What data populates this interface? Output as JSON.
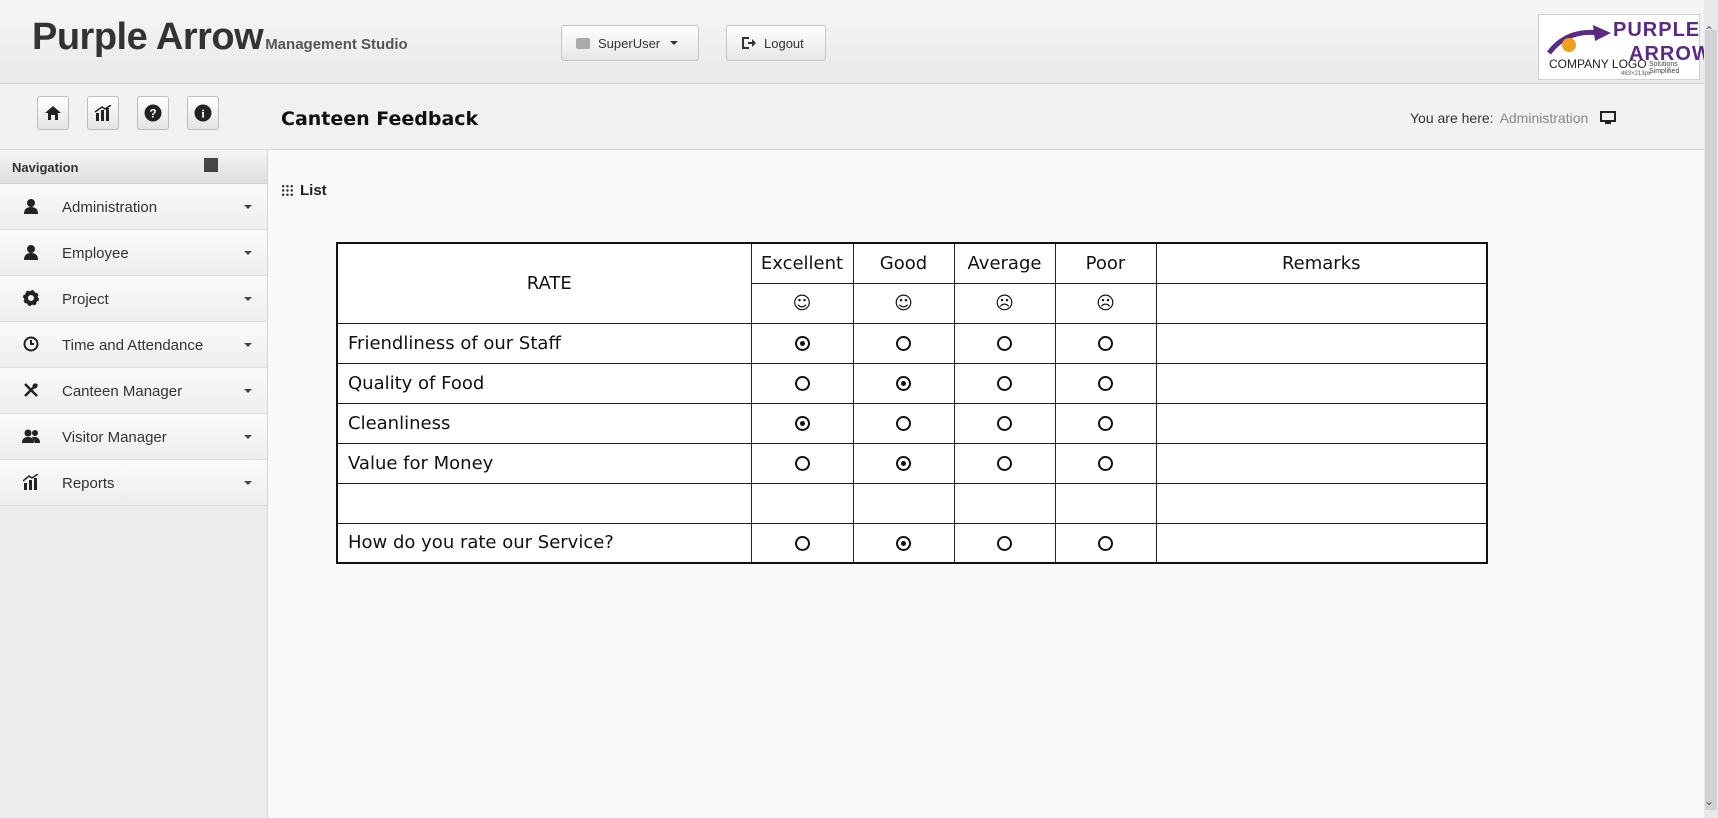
{
  "header": {
    "brand": "Purple Arrow",
    "brand_sub": "Management Studio",
    "user_label": "SuperUser",
    "logout_label": "Logout",
    "logo": {
      "line1": "PURPLE",
      "line2": "ARROW",
      "placeholder": "COMPANY LOGO",
      "tagline": "Solutions Simplified",
      "dims": "483×213px"
    }
  },
  "subheader": {
    "page_title": "Canteen Feedback",
    "breadcrumb_prefix": "You are here:",
    "breadcrumb_item": "Administration"
  },
  "sidebar": {
    "title": "Navigation",
    "items": [
      {
        "label": "Administration",
        "icon": "user-icon"
      },
      {
        "label": "Employee",
        "icon": "user-icon"
      },
      {
        "label": "Project",
        "icon": "gear-icon"
      },
      {
        "label": "Time and Attendance",
        "icon": "clock-icon"
      },
      {
        "label": "Canteen Manager",
        "icon": "utensils-icon"
      },
      {
        "label": "Visitor Manager",
        "icon": "users-icon"
      },
      {
        "label": "Reports",
        "icon": "chart-icon"
      }
    ]
  },
  "content": {
    "list_label": "List",
    "table": {
      "rate_header": "RATE",
      "remarks_header": "Remarks",
      "options": [
        "Excellent",
        "Good",
        "Average",
        "Poor"
      ],
      "smileys": [
        "☺",
        "☺",
        "☹",
        "☹"
      ],
      "rows": [
        {
          "label": "Friendliness of our Staff",
          "selected": 0
        },
        {
          "label": "Quality of Food",
          "selected": 1
        },
        {
          "label": "Cleanliness",
          "selected": 0
        },
        {
          "label": "Value for Money",
          "selected": 1
        }
      ],
      "service_row": {
        "label": "How do you rate our Service?",
        "selected": 1
      }
    }
  }
}
